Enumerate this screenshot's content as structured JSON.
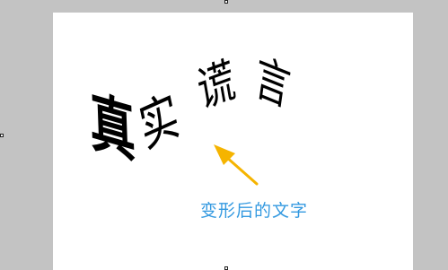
{
  "artwork": {
    "chars": [
      "真",
      "实",
      "谎",
      "言"
    ],
    "text_color": "#000000"
  },
  "annotation": {
    "label": "变形后的文字",
    "label_color": "#3399e0",
    "arrow_color": "#f5b400"
  },
  "canvas": {
    "workspace_color": "#c3c3c3",
    "page_color": "#ffffff"
  }
}
